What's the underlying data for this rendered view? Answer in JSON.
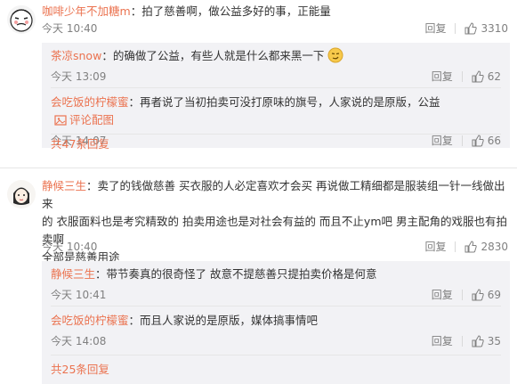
{
  "comments": [
    {
      "user": "咖啡少年不加糖m",
      "text": "：拍了慈善啊，做公益多好的事，正能量",
      "time": "今天 10:40",
      "reply_label": "回复",
      "likes": "3310",
      "replies": [
        {
          "user": "茶凉snow",
          "text": "：的确做了公益，有些人就是什么都来黑一下",
          "time": "今天 13:09",
          "reply_label": "回复",
          "likes": "62"
        },
        {
          "user": "会吃饭的柠檬蜜",
          "text": "：再者说了当初拍卖可没打原味的旗号，人家说的是原版，公益",
          "time": "今天 14:07",
          "reply_label": "回复",
          "likes": "66",
          "gift_label": "评论配图"
        }
      ],
      "more_label": "共47条回复"
    },
    {
      "user": "静候三生",
      "text_lines": [
        "：卖了的钱做慈善 买衣服的人必定喜欢才会买 再说做工精细都是服装组一针一线做出来",
        "的 衣服面料也是考究精致的 拍卖用途也是对社会有益的 而且不止ym吧 男主配角的戏服也有拍卖啊",
        "全部是慈善用途"
      ],
      "time": "今天 10:40",
      "reply_label": "回复",
      "likes": "2830",
      "replies": [
        {
          "user": "静候三生",
          "text": "：带节奏真的很奇怪了 故意不提慈善只提拍卖价格是何意",
          "time": "今天 10:41",
          "reply_label": "回复",
          "likes": "69"
        },
        {
          "user": "会吃饭的柠檬蜜",
          "text": "：而且人家说的是原版，媒体搞事情吧",
          "time": "今天 14:08",
          "reply_label": "回复",
          "likes": "35"
        }
      ],
      "more_label": "共25条回复"
    }
  ],
  "icons": {
    "thumb": "thumbs-up-icon",
    "gift": "image-icon",
    "emoji": "smirk-emoji-icon"
  },
  "colors": {
    "username": "#eb7350",
    "reply_bg": "#f2f2f5",
    "meta": "#808080"
  }
}
